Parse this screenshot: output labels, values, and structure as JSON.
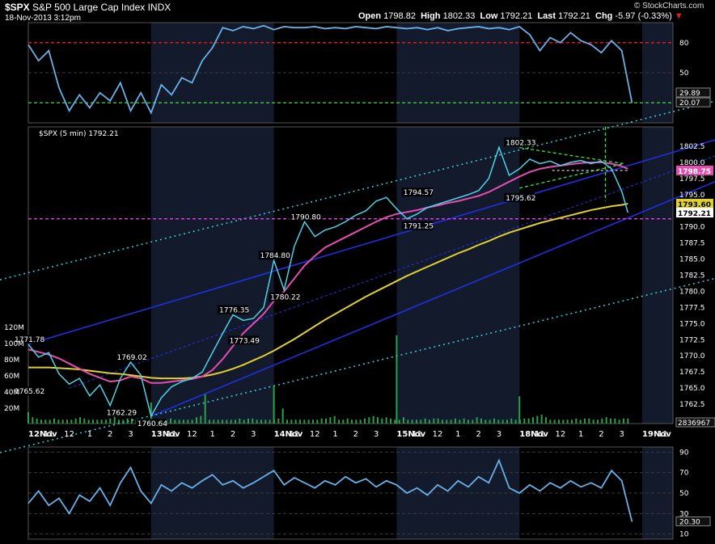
{
  "header": {
    "symbol": "$SPX",
    "name": "S&P 500 Large Cap Index",
    "exchange": "INDX",
    "datetime": "18-Nov-2013 3:12pm",
    "open_label": "Open",
    "open": "1798.82",
    "high_label": "High",
    "high": "1802.33",
    "low_label": "Low",
    "low": "1792.21",
    "last_label": "Last",
    "last": "1792.21",
    "chg_label": "Chg",
    "chg": "-5.97 (-0.33%)",
    "watermark": "© StockCharts.com"
  },
  "colors": {
    "background": "#000000",
    "plot_bg": "#000000",
    "band_bg": "#131a2b",
    "price": "#4fd1e6",
    "ma_short": "#e24fb0",
    "ma_long": "#e0d030",
    "channel": "#2030e0",
    "cyan_dotted": "#38c8d8",
    "magenta_dashed": "#e040e0",
    "green_dashed": "#40e040",
    "red_dashed": "#e02020",
    "volume": "#2aa048",
    "indicator": "#6ab0e8",
    "grid": "#3a3a3a",
    "text": "#ffffff"
  },
  "chart_data": {
    "type": "line",
    "title": "$SPX (5 min) 1792.21",
    "x_tick_labels": [
      "12Nov",
      "11",
      "12",
      "1",
      "2",
      "3",
      "13Nov",
      "11",
      "12",
      "1",
      "2",
      "3",
      "14Nov",
      "11",
      "12",
      "1",
      "2",
      "3",
      "15Nov",
      "11",
      "12",
      "1",
      "2",
      "3",
      "18Nov",
      "11",
      "12",
      "1",
      "2",
      "3",
      "19Nov",
      "11"
    ],
    "x_ticks": [
      0,
      1,
      2,
      3,
      4,
      5,
      6,
      7,
      8,
      9,
      10,
      11,
      12,
      13,
      14,
      15,
      16,
      17,
      18,
      19,
      20,
      21,
      22,
      23,
      24,
      25,
      26,
      27,
      28,
      29,
      30,
      31
    ],
    "session_boundaries": [
      0,
      6,
      12,
      18,
      24,
      30
    ],
    "upper_indicator": {
      "y_ticks": [
        80,
        50
      ],
      "overbought": 80,
      "oversold": 20.07,
      "last_values": [
        "29.89",
        "20.07"
      ],
      "ylim": [
        0,
        100
      ],
      "x": [
        0,
        0.5,
        1,
        1.5,
        2,
        2.5,
        3,
        3.5,
        4,
        4.5,
        5,
        5.5,
        6,
        6.5,
        7,
        7.5,
        8,
        8.5,
        9,
        9.5,
        10,
        10.5,
        11,
        11.5,
        12,
        12.5,
        13,
        13.5,
        14,
        14.5,
        15,
        15.5,
        16,
        16.5,
        17,
        17.5,
        18,
        18.5,
        19,
        19.5,
        20,
        20.5,
        21,
        21.5,
        22,
        22.5,
        23,
        23.5,
        24,
        24.5,
        25,
        25.5,
        26,
        26.5,
        27,
        27.5,
        28,
        28.5,
        29,
        29.5
      ],
      "values": [
        78,
        62,
        72,
        35,
        12,
        28,
        15,
        30,
        22,
        40,
        12,
        30,
        10,
        38,
        28,
        45,
        40,
        62,
        75,
        95,
        92,
        96,
        94,
        97,
        93,
        96,
        95,
        95,
        96,
        94,
        95,
        94,
        96,
        95,
        94,
        96,
        95,
        94,
        95,
        93,
        95,
        92,
        94,
        95,
        96,
        94,
        95,
        93,
        96,
        88,
        72,
        85,
        80,
        90,
        82,
        78,
        70,
        82,
        72,
        20
      ]
    },
    "price": {
      "ylabel": "",
      "ylim": [
        1759.5,
        1805.5
      ],
      "y_ticks": [
        1802.5,
        1800.0,
        1797.5,
        1795.0,
        1792.5,
        1790.0,
        1787.5,
        1785.0,
        1782.5,
        1780.0,
        1777.5,
        1775.0,
        1772.5,
        1770.0,
        1767.5,
        1765.0,
        1762.5,
        1760.0
      ],
      "x": [
        0,
        0.5,
        1,
        1.5,
        2,
        2.5,
        3,
        3.5,
        4,
        4.5,
        5,
        5.5,
        6,
        6.5,
        7,
        7.5,
        8,
        8.5,
        9,
        9.5,
        10,
        10.5,
        11,
        11.5,
        12,
        12.5,
        13,
        13.5,
        14,
        14.5,
        15,
        15.5,
        16,
        16.5,
        17,
        17.5,
        18,
        18.5,
        19,
        19.5,
        20,
        20.5,
        21,
        21.5,
        22,
        22.5,
        23,
        23.5,
        24,
        24.5,
        25,
        25.5,
        26,
        26.5,
        27,
        27.5,
        28,
        28.5,
        29,
        29.3
      ],
      "values": [
        1771.78,
        1769.8,
        1770.5,
        1767.2,
        1765.62,
        1766.5,
        1763.8,
        1765.5,
        1762.29,
        1766.5,
        1769.02,
        1767.0,
        1760.64,
        1763.5,
        1765.2,
        1766.0,
        1766.5,
        1767.5,
        1770.5,
        1773.49,
        1776.35,
        1775.5,
        1775.8,
        1777.5,
        1784.8,
        1780.22,
        1787.0,
        1790.8,
        1788.5,
        1789.5,
        1790.0,
        1790.8,
        1791.8,
        1792.5,
        1794.0,
        1794.57,
        1792.8,
        1791.25,
        1792.0,
        1793.0,
        1793.5,
        1794.0,
        1794.5,
        1795.0,
        1795.62,
        1797.5,
        1802.33,
        1798.0,
        1799.0,
        1800.5,
        1799.8,
        1800.2,
        1799.5,
        1800.0,
        1800.3,
        1799.8,
        1800.2,
        1799.0,
        1795.5,
        1792.21
      ],
      "ma_short": [
        1771.0,
        1770.6,
        1770.2,
        1769.6,
        1768.8,
        1768.0,
        1767.2,
        1766.6,
        1766.0,
        1766.2,
        1766.8,
        1766.5,
        1765.8,
        1765.8,
        1766.0,
        1766.2,
        1766.4,
        1766.8,
        1767.8,
        1769.5,
        1771.5,
        1773.5,
        1775.0,
        1776.5,
        1778.5,
        1780.0,
        1782.0,
        1784.0,
        1785.5,
        1786.8,
        1787.6,
        1788.4,
        1789.2,
        1790.0,
        1790.8,
        1791.5,
        1792.0,
        1792.3,
        1792.6,
        1793.0,
        1793.3,
        1793.7,
        1794.0,
        1794.4,
        1794.8,
        1795.4,
        1796.2,
        1797.0,
        1797.8,
        1798.5,
        1799.0,
        1799.3,
        1799.5,
        1799.7,
        1799.9,
        1800.0,
        1800.0,
        1799.8,
        1799.4,
        1799.0
      ],
      "ma_long": [
        1768.2,
        1768.2,
        1768.2,
        1768.1,
        1768.0,
        1767.9,
        1767.7,
        1767.5,
        1767.3,
        1767.2,
        1767.0,
        1766.8,
        1766.6,
        1766.5,
        1766.5,
        1766.5,
        1766.6,
        1766.8,
        1767.1,
        1767.5,
        1768.0,
        1768.6,
        1769.3,
        1770.0,
        1770.8,
        1771.7,
        1772.6,
        1773.6,
        1774.6,
        1775.6,
        1776.5,
        1777.4,
        1778.3,
        1779.2,
        1780.0,
        1780.8,
        1781.6,
        1782.4,
        1783.1,
        1783.8,
        1784.5,
        1785.2,
        1785.9,
        1786.5,
        1787.2,
        1787.8,
        1788.5,
        1789.1,
        1789.6,
        1790.1,
        1790.6,
        1791.0,
        1791.4,
        1791.8,
        1792.2,
        1792.6,
        1792.9,
        1793.2,
        1793.4,
        1793.6
      ],
      "labels": [
        {
          "x": 0,
          "y": 1771.78,
          "text": "1771.78",
          "pos": "above"
        },
        {
          "x": 0,
          "y": 1765.62,
          "text": "1765.62",
          "pos": "below"
        },
        {
          "x": 5,
          "y": 1769.02,
          "text": "1769.02",
          "pos": "above"
        },
        {
          "x": 4.5,
          "y": 1762.29,
          "text": "1762.29",
          "pos": "below"
        },
        {
          "x": 6,
          "y": 1760.64,
          "text": "1760.64",
          "pos": "below"
        },
        {
          "x": 10,
          "y": 1776.35,
          "text": "1776.35",
          "pos": "above"
        },
        {
          "x": 10.5,
          "y": 1773.49,
          "text": "1773.49",
          "pos": "below"
        },
        {
          "x": 12,
          "y": 1784.8,
          "text": "1784.80",
          "pos": "above"
        },
        {
          "x": 12.5,
          "y": 1780.22,
          "text": "1780.22",
          "pos": "below"
        },
        {
          "x": 13.5,
          "y": 1790.8,
          "text": "1790.80",
          "pos": "above"
        },
        {
          "x": 19,
          "y": 1794.57,
          "text": "1794.57",
          "pos": "above"
        },
        {
          "x": 19,
          "y": 1791.25,
          "text": "1791.25",
          "pos": "below"
        },
        {
          "x": 24,
          "y": 1802.33,
          "text": "1802.33",
          "pos": "above"
        },
        {
          "x": 24,
          "y": 1795.62,
          "text": "1795.62",
          "pos": "below"
        }
      ],
      "last_value_tags": [
        {
          "y": 1798.75,
          "text": "1798.75",
          "bg": "#e24fb0",
          "fg": "#ffffff"
        },
        {
          "y": 1793.6,
          "text": "1793.60",
          "bg": "#e0d030",
          "fg": "#000000"
        },
        {
          "y": 1792.21,
          "text": "1792.21",
          "bg": "#ffffff",
          "fg": "#000000"
        }
      ],
      "support_level": 1791.25,
      "volume_y_ticks": [
        "120M",
        "100M",
        "80M",
        "60M",
        "40M",
        "20M"
      ],
      "volume_last": "2836967",
      "volume_values": [
        9,
        5,
        4,
        3,
        3,
        3,
        4,
        3,
        3,
        3,
        3,
        4,
        5,
        4,
        3,
        3,
        3,
        3,
        3,
        4,
        10,
        3,
        3,
        4,
        4,
        3,
        3,
        3,
        3,
        3,
        3,
        4,
        3,
        4,
        3,
        3,
        3,
        3,
        3,
        5,
        6,
        24,
        3,
        3,
        3,
        3,
        3,
        3,
        3,
        4,
        3,
        4,
        4,
        3,
        3,
        3,
        3,
        3,
        4,
        12,
        3,
        3,
        3,
        3,
        3,
        3,
        3,
        3,
        4,
        4,
        5,
        6,
        3,
        3,
        4,
        3,
        3,
        3,
        4,
        5,
        6,
        5,
        4,
        5,
        4,
        3,
        3,
        5,
        3,
        3,
        3,
        3,
        4,
        3,
        4,
        4,
        3,
        3,
        3,
        4,
        3,
        4,
        3,
        3,
        5,
        4,
        3,
        3,
        4,
        3,
        3,
        3,
        4,
        3,
        3,
        4,
        4,
        5,
        6,
        7,
        5,
        3,
        3,
        3,
        3,
        3,
        3,
        4,
        3,
        4,
        4,
        3,
        3,
        4,
        5,
        4,
        4,
        3,
        4,
        4
      ],
      "volume_spikes": [
        {
          "x": 18,
          "v": 42
        },
        {
          "x": 12,
          "v": 18
        },
        {
          "x": 6,
          "v": 10
        },
        {
          "x": 24,
          "v": 13
        }
      ]
    },
    "lower_indicator": {
      "y_ticks": [
        90,
        70,
        50,
        30,
        10
      ],
      "last_value": "20.30",
      "ylim": [
        5,
        95
      ],
      "x": [
        0,
        0.5,
        1,
        1.5,
        2,
        2.5,
        3,
        3.5,
        4,
        4.5,
        5,
        5.5,
        6,
        6.5,
        7,
        7.5,
        8,
        8.5,
        9,
        9.5,
        10,
        10.5,
        11,
        11.5,
        12,
        12.5,
        13,
        13.5,
        14,
        14.5,
        15,
        15.5,
        16,
        16.5,
        17,
        17.5,
        18,
        18.5,
        19,
        19.5,
        20,
        20.5,
        21,
        21.5,
        22,
        22.5,
        23,
        23.5,
        24,
        24.5,
        25,
        25.5,
        26,
        26.5,
        27,
        27.5,
        28,
        28.5,
        29,
        29.5
      ],
      "values": [
        40,
        52,
        38,
        45,
        30,
        48,
        42,
        55,
        38,
        60,
        75,
        52,
        40,
        58,
        52,
        60,
        55,
        62,
        68,
        58,
        62,
        55,
        60,
        66,
        72,
        58,
        65,
        60,
        55,
        62,
        58,
        66,
        60,
        64,
        56,
        62,
        58,
        50,
        55,
        48,
        58,
        52,
        62,
        56,
        66,
        60,
        82,
        55,
        50,
        58,
        52,
        60,
        55,
        62,
        56,
        60,
        55,
        72,
        62,
        22
      ]
    }
  }
}
